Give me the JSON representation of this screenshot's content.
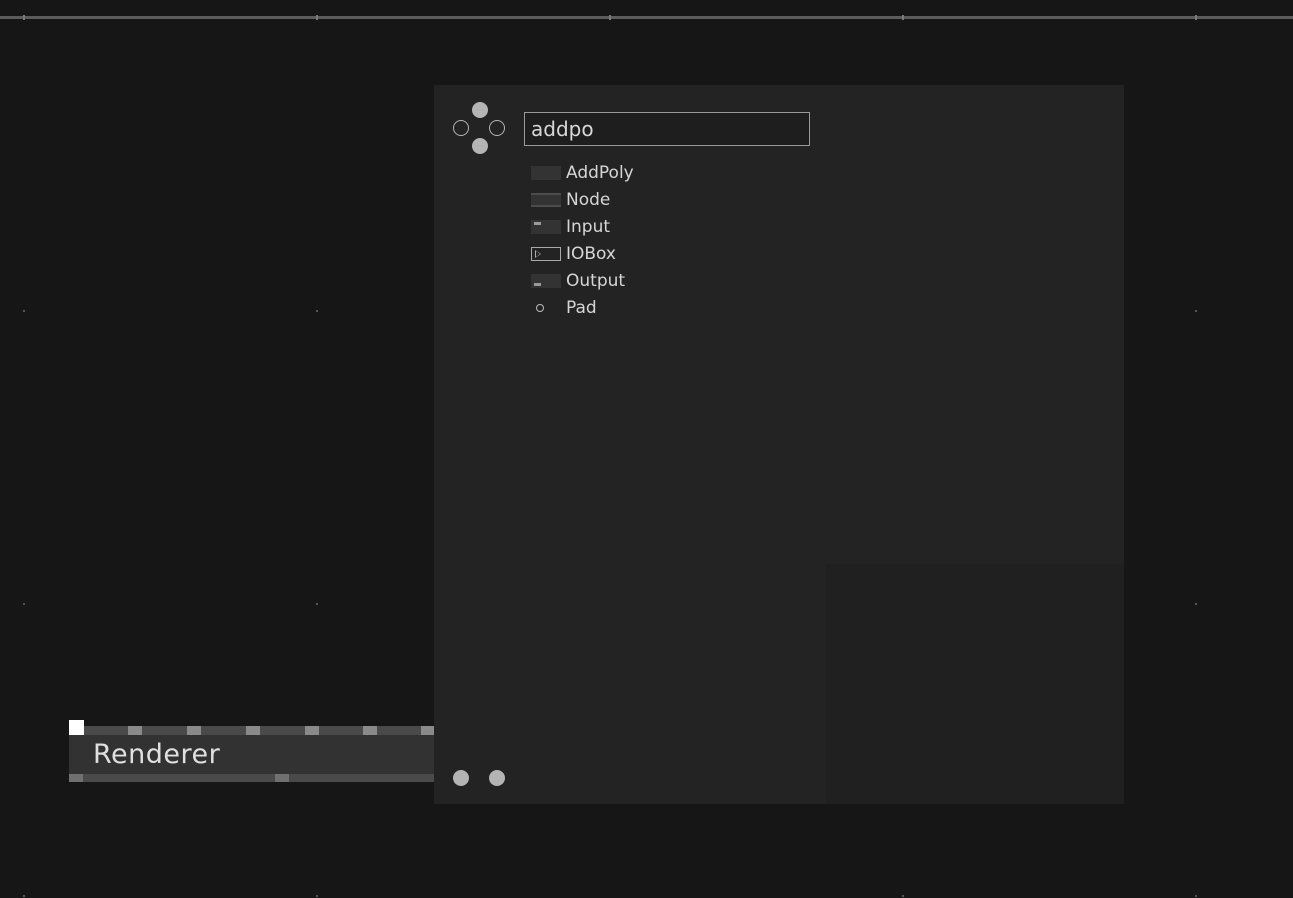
{
  "canvas": {
    "node": {
      "label": "Renderer"
    }
  },
  "browser": {
    "search": {
      "value": "addpo",
      "placeholder": ""
    },
    "results": [
      {
        "label": "AddPoly",
        "icon": "addpoly-icon"
      },
      {
        "label": "Node",
        "icon": "node-icon"
      },
      {
        "label": "Input",
        "icon": "input-pin-icon"
      },
      {
        "label": "IOBox",
        "icon": "iobox-icon"
      },
      {
        "label": "Output",
        "icon": "output-pin-icon"
      },
      {
        "label": "Pad",
        "icon": "pad-icon"
      }
    ]
  },
  "colors": {
    "background": "#161616",
    "panel": "#232323",
    "node": "#323232",
    "text": "#d6d6d6",
    "accent_dot": "#b4b4b4"
  }
}
